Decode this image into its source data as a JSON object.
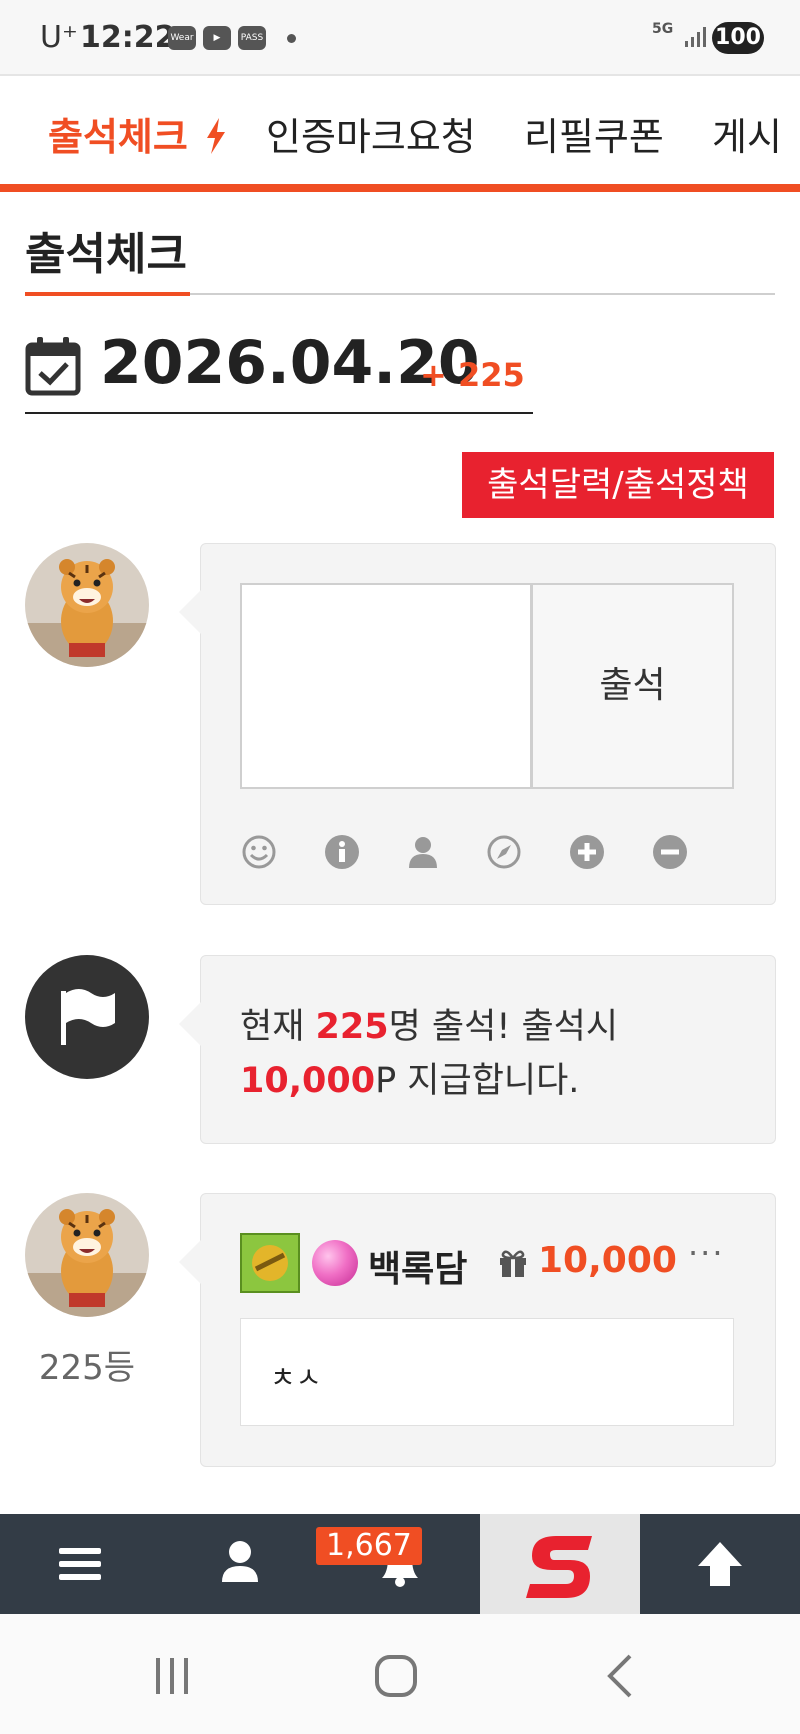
{
  "status_bar": {
    "carrier": "U⁺",
    "time": "12:22",
    "icons": [
      "Wear",
      "▶",
      "PASS"
    ],
    "network": "5G",
    "battery": "100"
  },
  "nav": {
    "tabs": [
      "출석체크",
      "인증마크요청",
      "리필쿠폰",
      "게시"
    ],
    "active_index": 0
  },
  "section": {
    "title": "출석체크"
  },
  "date": {
    "value": "2026.04.20",
    "count_plus": "+ 225"
  },
  "calendar_button": {
    "label": "출석달력/출석정책"
  },
  "attend_form": {
    "submit_label": "출석",
    "tool_icons": [
      "smiley-icon",
      "info-icon",
      "user-icon",
      "compass-icon",
      "plus-circle-icon",
      "minus-circle-icon"
    ]
  },
  "notice": {
    "prefix": "현재 ",
    "count": "225",
    "mid": "명 출석! 출석시",
    "points": "10,000",
    "suffix": "P 지급합니다."
  },
  "entry": {
    "rank": "225등",
    "username": "백록담",
    "points": "10,000",
    "more": "···",
    "comment": "ㅊㅅ"
  },
  "bottom_bar": {
    "notification_count": "1,667"
  },
  "colors": {
    "accent": "#f04e23",
    "red": "#e8222f",
    "bottom_bar": "#333c46"
  }
}
